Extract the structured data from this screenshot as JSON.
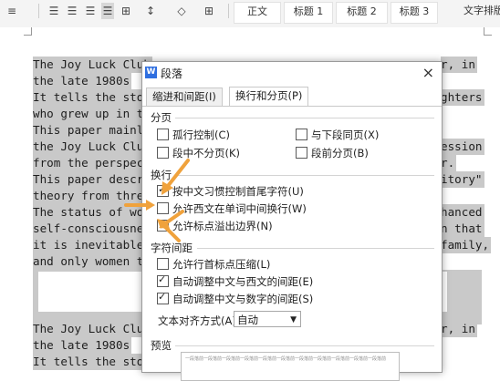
{
  "ribbon": {
    "styles": [
      "正文",
      "标题 1",
      "标题 2",
      "标题 3",
      "文字排版"
    ],
    "style_cut_label": "ー"
  },
  "document": {
    "lines": [
      "The Joy Luck Club",
      "r, in",
      "the late 1980s",
      "It tells the story",
      "ghters",
      "who grew up in th",
      "This paper mainly",
      "the Joy Luck Club",
      "ession",
      "from the perspect",
      "r.",
      "This paper descr",
      "itory\"",
      "theory from three",
      "The status of wom",
      "hanced",
      "self-consciousnes",
      "n that",
      "it is inevitable f",
      "family,",
      "and only women th",
      "The Joy Luck Club",
      "r, in",
      "the late 1980s",
      "It tells the stor"
    ]
  },
  "dialog": {
    "title": "段落",
    "close": "×",
    "tabs": [
      "缩进和间距(I)",
      "换行和分页(P)"
    ],
    "active_tab": 1,
    "pagination": {
      "heading": "分页",
      "widow_control": "孤行控制(C)",
      "keep_with_next": "与下段同页(X)",
      "keep_lines_together": "段中不分页(K)",
      "page_break_before": "段前分页(B)"
    },
    "line_break": {
      "heading": "换行",
      "first_last_char": "按中文习惯控制首尾字符(U)",
      "allow_word_wrap": "允许西文在单词中间换行(W)",
      "allow_punct_overflow": "允许标点溢出边界(N)"
    },
    "char_spacing": {
      "heading": "字符间距",
      "compress_punct": "允许行首标点压缩(L)",
      "auto_cn_en": "自动调整中文与西文的间距(E)",
      "auto_cn_num": "自动调整中文与数字的间距(S)"
    },
    "alignment": {
      "label": "文本对齐方式(A):",
      "value": "自动",
      "arrow": "▼"
    },
    "preview_label": "预览",
    "preview_text": "一段落前一段落前一段落前一段落前一段落前一段落前一段落前一段落前一段落前一段落前一段落前"
  },
  "colors": {
    "arrow": "#f0a23c",
    "highlight": "#c9c9c9",
    "ribbon": "#f4f4f4"
  }
}
